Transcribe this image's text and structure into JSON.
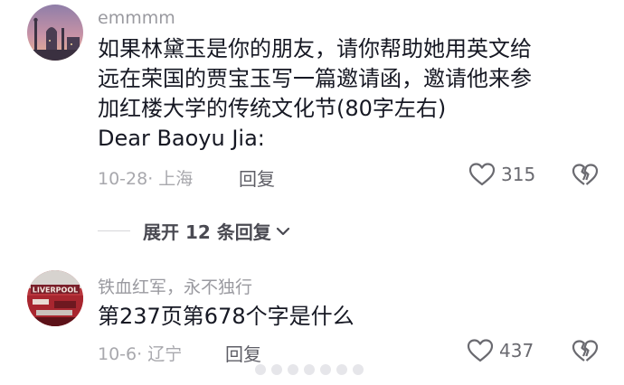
{
  "comments": [
    {
      "username": "emmmm",
      "text_lines": [
        "如果林黛玉是你的朋友，请你帮助她用英文给",
        "远在荣国的贾宝玉写一篇邀请函，邀请他来参",
        "加红楼大学的传统文化节(80字左右)",
        "Dear Baoyu Jia:"
      ],
      "date_location": "10-28· 上海",
      "reply_label": "回复",
      "like_count": "315",
      "expand_replies_label": "展开 12 条回复"
    },
    {
      "username": "铁血红军，永不独行",
      "text_lines": [
        "第237页第678个字是什么"
      ],
      "date_location": "10-6· 辽宁",
      "reply_label": "回复",
      "like_count": "437"
    }
  ],
  "colors": {
    "text_primary": "#161823",
    "text_secondary": "#9a9aa0",
    "meta": "#a8a8ad",
    "icon": "#6a6a70"
  },
  "icons": [
    "heart-icon",
    "broken-heart-icon",
    "chevron-down-icon"
  ]
}
